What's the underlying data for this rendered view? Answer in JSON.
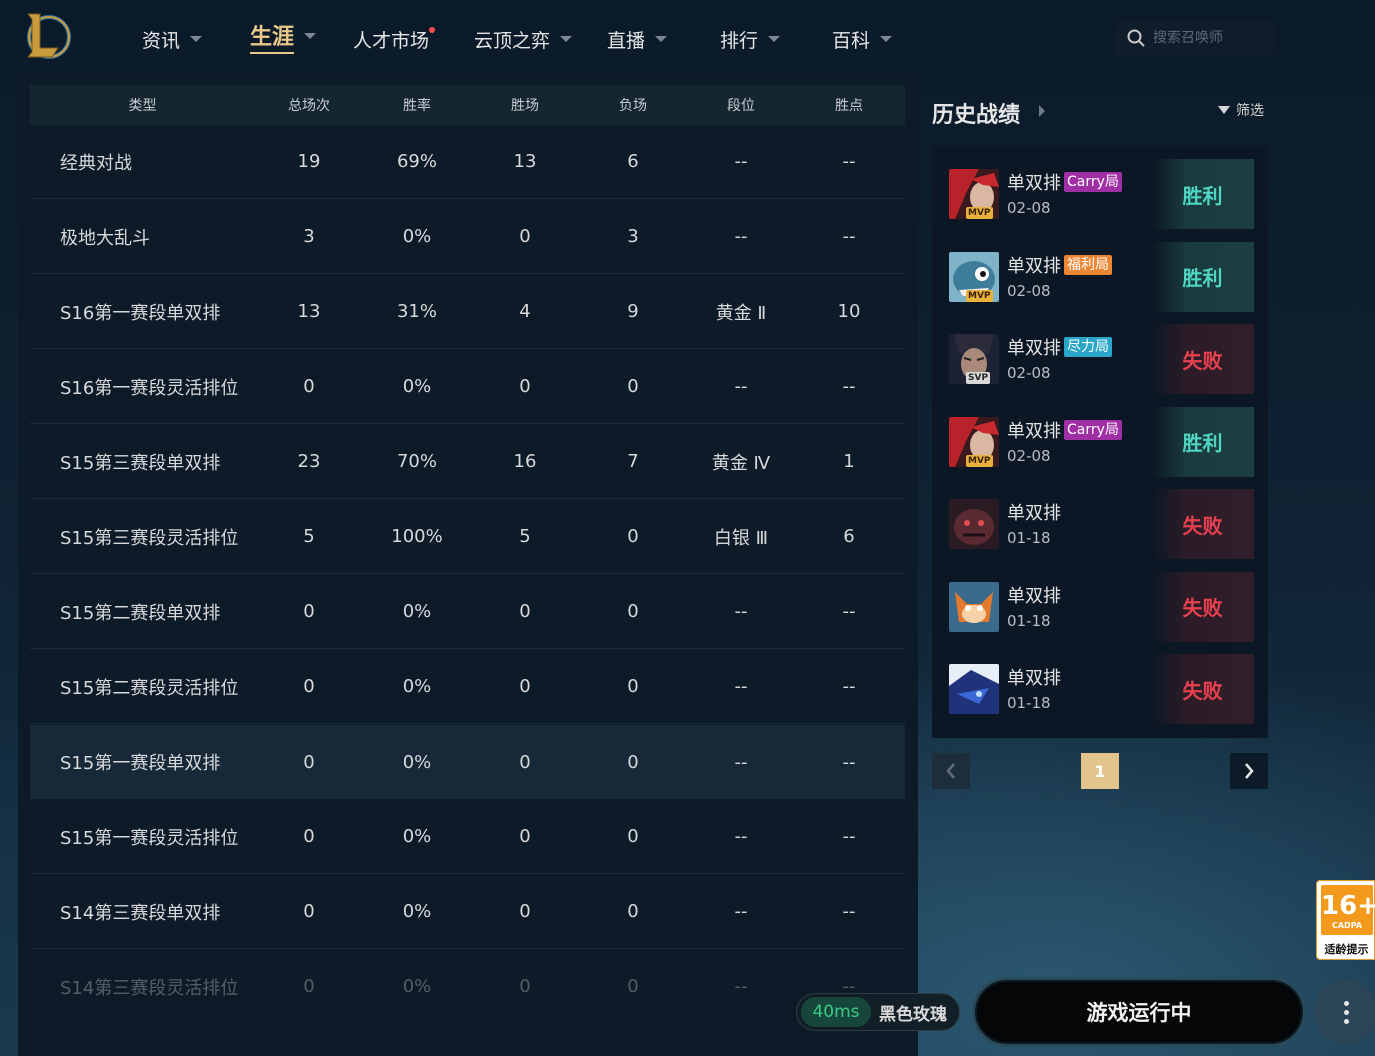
{
  "nav": {
    "items": [
      {
        "label": "资讯",
        "caret": true
      },
      {
        "label": "生涯",
        "caret": true,
        "active": true
      },
      {
        "label": "人才市场",
        "caret": false,
        "dot": true
      },
      {
        "label": "云顶之弈",
        "caret": true
      },
      {
        "label": "直播",
        "caret": true
      },
      {
        "label": "排行",
        "caret": true
      },
      {
        "label": "百科",
        "caret": true
      }
    ],
    "search_placeholder": "搜索召唤师"
  },
  "stats": {
    "headers": [
      "类型",
      "总场次",
      "胜率",
      "胜场",
      "负场",
      "段位",
      "胜点"
    ],
    "rows": [
      [
        "经典对战",
        "19",
        "69%",
        "13",
        "6",
        "--",
        "--"
      ],
      [
        "极地大乱斗",
        "3",
        "0%",
        "0",
        "3",
        "--",
        "--"
      ],
      [
        "S16第一赛段单双排",
        "13",
        "31%",
        "4",
        "9",
        "黄金 Ⅱ",
        "10"
      ],
      [
        "S16第一赛段灵活排位",
        "0",
        "0%",
        "0",
        "0",
        "--",
        "--"
      ],
      [
        "S15第三赛段单双排",
        "23",
        "70%",
        "16",
        "7",
        "黄金 Ⅳ",
        "1"
      ],
      [
        "S15第三赛段灵活排位",
        "5",
        "100%",
        "5",
        "0",
        "白银 Ⅲ",
        "6"
      ],
      [
        "S15第二赛段单双排",
        "0",
        "0%",
        "0",
        "0",
        "--",
        "--"
      ],
      [
        "S15第二赛段灵活排位",
        "0",
        "0%",
        "0",
        "0",
        "--",
        "--"
      ],
      [
        "S15第一赛段单双排",
        "0",
        "0%",
        "0",
        "0",
        "--",
        "--"
      ],
      [
        "S15第一赛段灵活排位",
        "0",
        "0%",
        "0",
        "0",
        "--",
        "--"
      ],
      [
        "S14第三赛段单双排",
        "0",
        "0%",
        "0",
        "0",
        "--",
        "--"
      ],
      [
        "S14第三赛段灵活排位",
        "0",
        "0%",
        "0",
        "0",
        "--",
        "--"
      ]
    ]
  },
  "history": {
    "title": "历史战绩",
    "filter_label": "筛选",
    "matches": [
      {
        "mode": "单双排",
        "tag": "Carry局",
        "tag_type": "carry",
        "badge": "MVP",
        "date": "02-08",
        "result": "胜利",
        "win": true,
        "champ": "red-hair"
      },
      {
        "mode": "单双排",
        "tag": "福利局",
        "tag_type": "fuli",
        "badge": "MVP",
        "date": "02-08",
        "result": "胜利",
        "win": true,
        "champ": "fish"
      },
      {
        "mode": "单双排",
        "tag": "尽力局",
        "tag_type": "jinli",
        "badge": "SVP",
        "date": "02-08",
        "result": "失败",
        "win": false,
        "champ": "dark-hair"
      },
      {
        "mode": "单双排",
        "tag": "Carry局",
        "tag_type": "carry",
        "badge": "MVP",
        "date": "02-08",
        "result": "胜利",
        "win": true,
        "champ": "red-hair"
      },
      {
        "mode": "单双排",
        "tag": "",
        "tag_type": "",
        "badge": "",
        "date": "01-18",
        "result": "失败",
        "win": false,
        "champ": "monster"
      },
      {
        "mode": "单双排",
        "tag": "",
        "tag_type": "",
        "badge": "",
        "date": "01-18",
        "result": "失败",
        "win": false,
        "champ": "fox"
      },
      {
        "mode": "单双排",
        "tag": "",
        "tag_type": "",
        "badge": "",
        "date": "01-18",
        "result": "失败",
        "win": false,
        "champ": "blue-creature"
      }
    ],
    "page": "1"
  },
  "age_badge": {
    "rating": "16+",
    "org": "CADPA",
    "tip": "适龄提示"
  },
  "bottom": {
    "ping": "40ms",
    "server": "黑色玫瑰",
    "play_label": "游戏运行中"
  },
  "colors": {
    "accent_gold": "#e9c98a",
    "win": "#4fd6c2",
    "loss": "#e9404f"
  }
}
